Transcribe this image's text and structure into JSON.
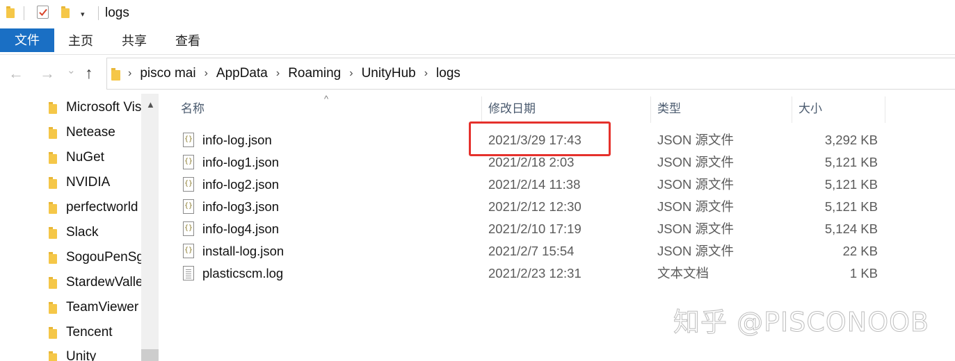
{
  "window": {
    "title": "logs"
  },
  "quick_access": {
    "dropdown_glyph": "▾"
  },
  "ribbon": {
    "tabs": [
      "文件",
      "主页",
      "共享",
      "查看"
    ]
  },
  "nav": {
    "back_glyph": "←",
    "forward_glyph": "→",
    "recent_glyph": "⌄",
    "up_glyph": "↑"
  },
  "address": {
    "separator": "›",
    "breadcrumbs": [
      "pisco mai",
      "AppData",
      "Roaming",
      "UnityHub",
      "logs"
    ]
  },
  "sidebar": {
    "items": [
      {
        "label": "Microsoft Visual Studio"
      },
      {
        "label": "Netease"
      },
      {
        "label": "NuGet"
      },
      {
        "label": "NVIDIA"
      },
      {
        "label": "perfectworld"
      },
      {
        "label": "Slack"
      },
      {
        "label": "SogouPenSg"
      },
      {
        "label": "StardewValley"
      },
      {
        "label": "TeamViewer"
      },
      {
        "label": "Tencent"
      },
      {
        "label": "Unity"
      }
    ],
    "scroll_up_glyph": "▲"
  },
  "columns": {
    "name": "名称",
    "date": "修改日期",
    "type": "类型",
    "size": "大小",
    "sort_glyph": "^"
  },
  "files": [
    {
      "name": "info-log.json",
      "date": "2021/3/29 17:43",
      "type": "JSON 源文件",
      "size": "3,292 KB",
      "icon": "json-file-icon"
    },
    {
      "name": "info-log1.json",
      "date": "2021/2/18 2:03",
      "type": "JSON 源文件",
      "size": "5,121 KB",
      "icon": "json-file-icon"
    },
    {
      "name": "info-log2.json",
      "date": "2021/2/14 11:38",
      "type": "JSON 源文件",
      "size": "5,121 KB",
      "icon": "json-file-icon"
    },
    {
      "name": "info-log3.json",
      "date": "2021/2/12 12:30",
      "type": "JSON 源文件",
      "size": "5,121 KB",
      "icon": "json-file-icon"
    },
    {
      "name": "info-log4.json",
      "date": "2021/2/10 17:19",
      "type": "JSON 源文件",
      "size": "5,124 KB",
      "icon": "json-file-icon"
    },
    {
      "name": "install-log.json",
      "date": "2021/2/7 15:54",
      "type": "JSON 源文件",
      "size": "22 KB",
      "icon": "json-file-icon"
    },
    {
      "name": "plasticscm.log",
      "date": "2021/2/23 12:31",
      "type": "文本文档",
      "size": "1 KB",
      "icon": "text-file-icon"
    }
  ],
  "json_icon_glyph": "{}",
  "watermark": "知乎 @PISCONOOB",
  "colors": {
    "file_tab_bg": "#1a6fc4",
    "highlight_border": "#e5312c",
    "folder_yellow": "#f5c748"
  }
}
